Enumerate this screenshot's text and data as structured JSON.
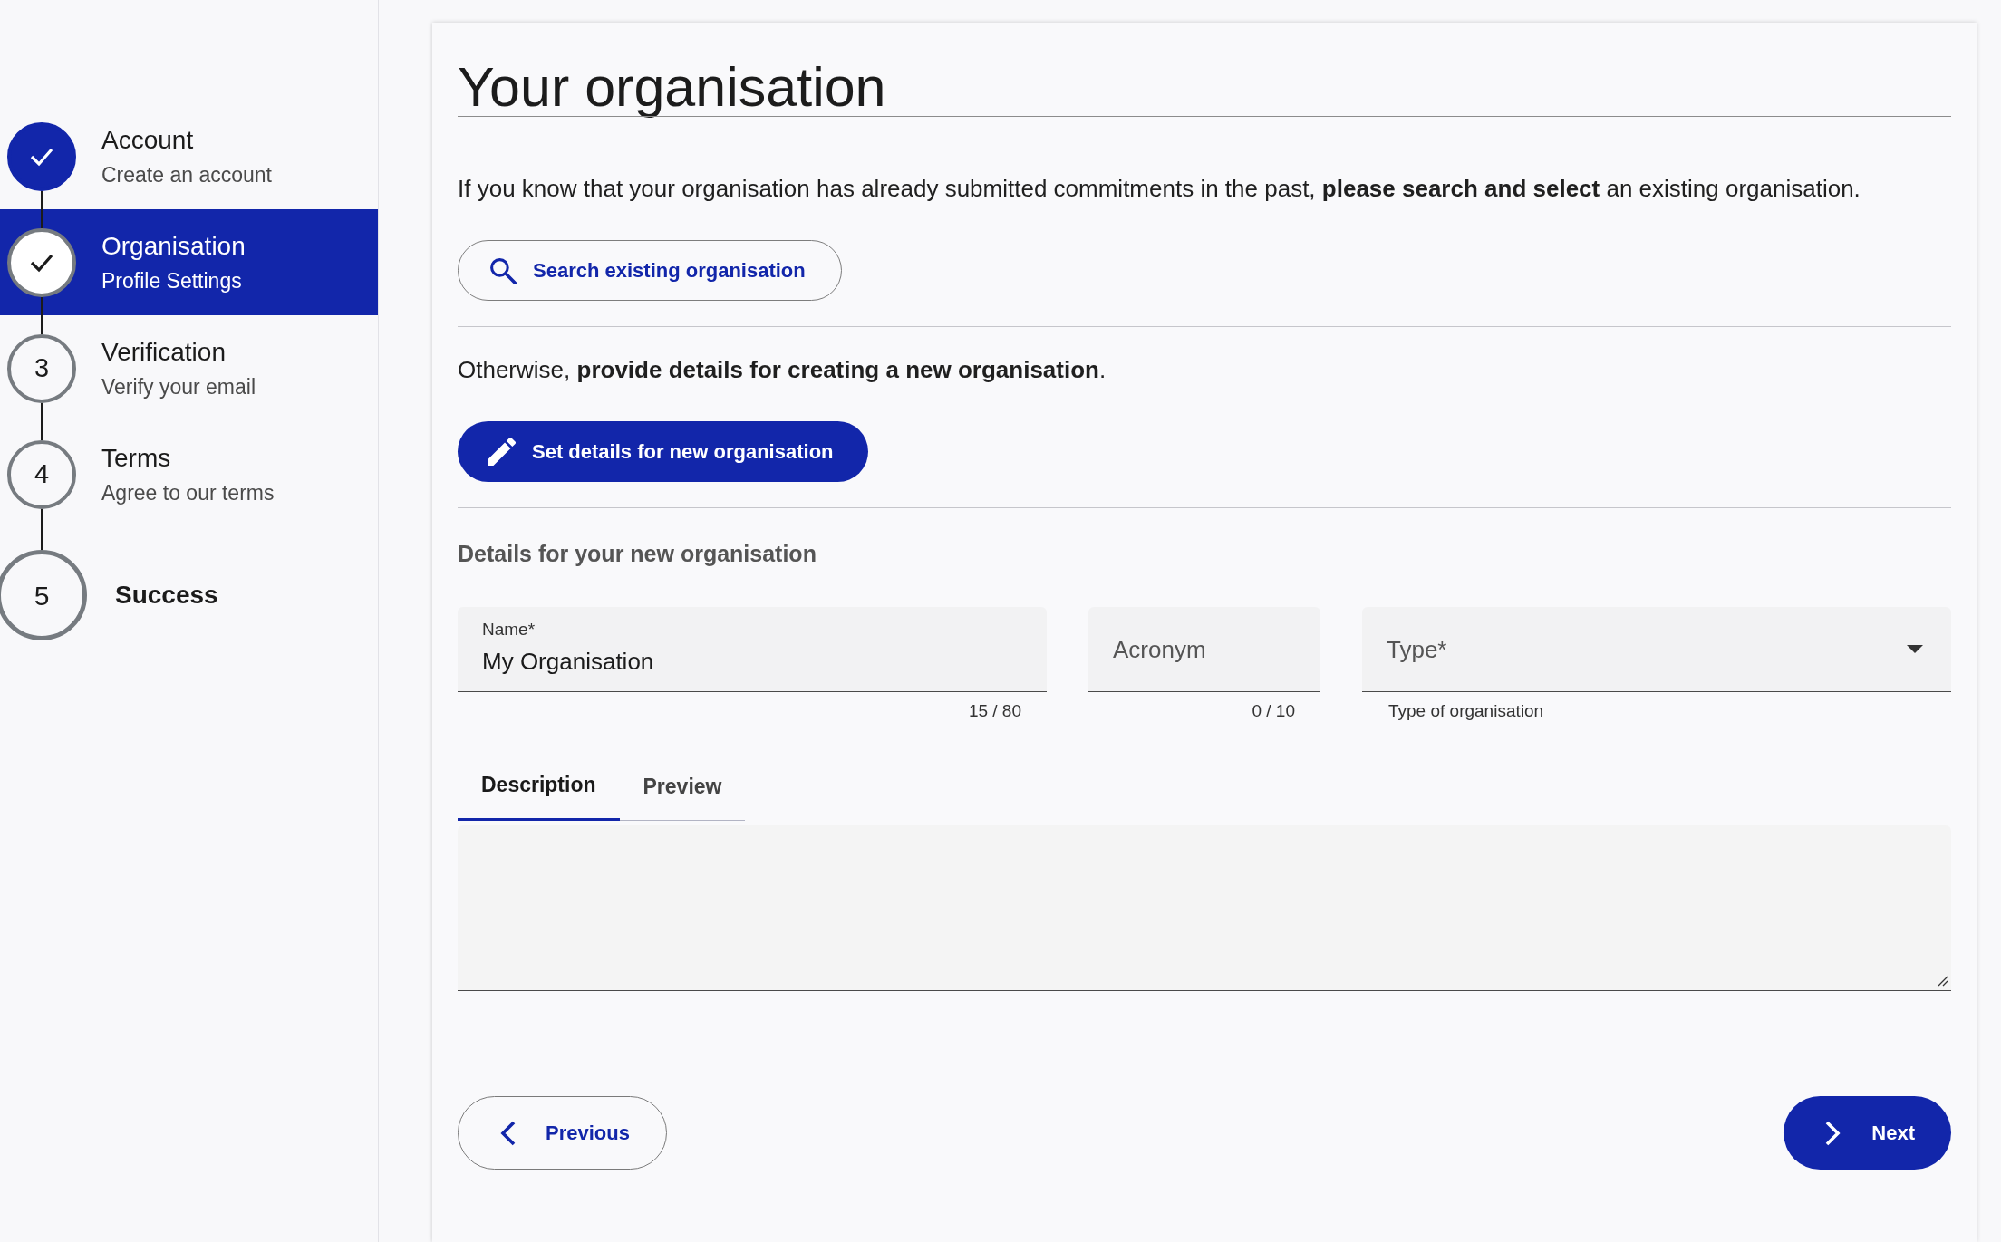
{
  "steps": [
    {
      "title": "Account",
      "subtitle": "Create an account",
      "kind": "step",
      "completed": true,
      "selected": false
    },
    {
      "title": "Organisation",
      "subtitle": "Profile Settings",
      "kind": "step",
      "completed": true,
      "selected": true
    },
    {
      "title": "Verification",
      "subtitle": "Verify your email",
      "number": "3",
      "kind": "step",
      "completed": false,
      "selected": false
    },
    {
      "title": "Terms",
      "subtitle": "Agree to our terms",
      "number": "4",
      "kind": "step",
      "completed": false,
      "selected": false
    },
    {
      "title": "Success",
      "number": "5",
      "kind": "final",
      "completed": false,
      "selected": false
    }
  ],
  "page": {
    "title": "Your organisation",
    "search_intro": "If you know that your organisation has already submitted commitments in the past, **please search and select** an existing organisation.",
    "search_button": "Search existing organisation",
    "create_intro": "Otherwise, **provide details for creating a new organisation**.",
    "create_button": "Set details for new organisation",
    "details_heading": "Details for your new organisation",
    "fields": [
      {
        "kind": "text",
        "label": "Name*",
        "value": "My Organisation",
        "counter": "15 / 80"
      },
      {
        "kind": "text",
        "label": "Acronym",
        "counter": "0 / 10"
      },
      {
        "kind": "select",
        "label": "Type*",
        "hint": "Type of organisation"
      }
    ],
    "tabs": [
      {
        "label": "Description",
        "selected": true
      },
      {
        "label": "Preview",
        "selected": false
      }
    ],
    "navigation": {
      "previous": "Previous",
      "next": "Next"
    }
  }
}
